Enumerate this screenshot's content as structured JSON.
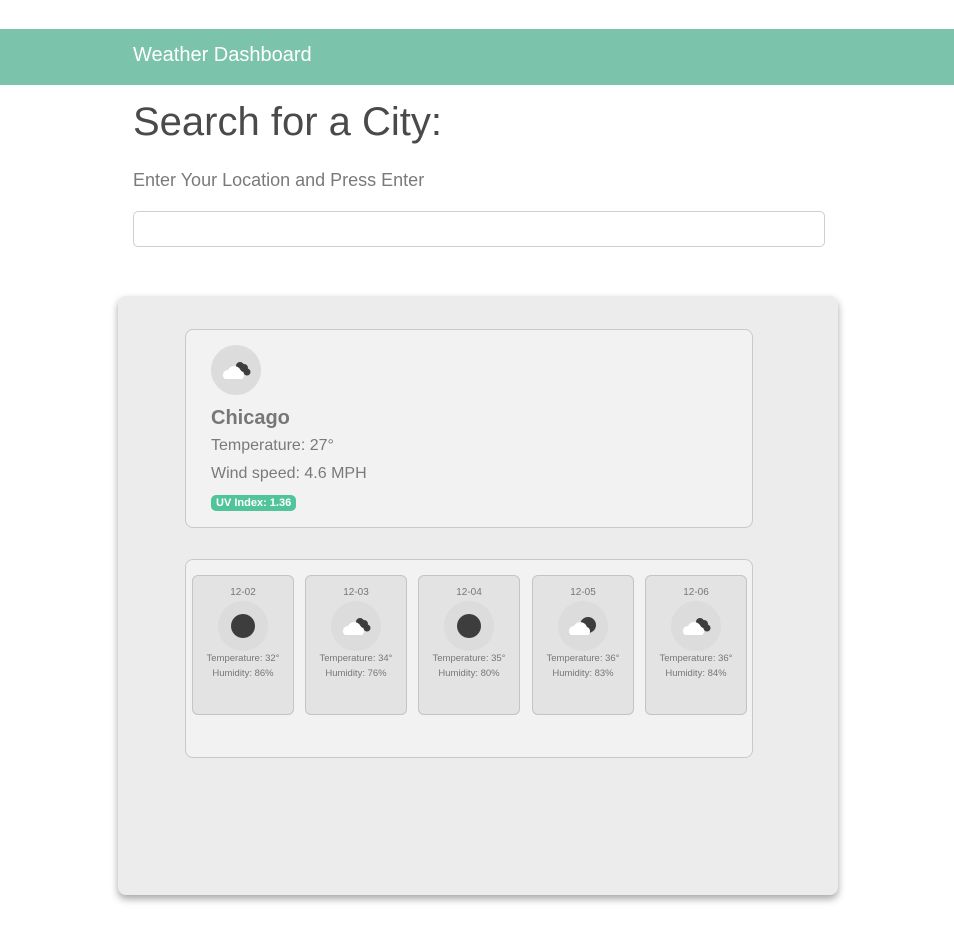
{
  "navbar": {
    "title": "Weather Dashboard"
  },
  "search": {
    "heading": "Search for a City:",
    "subheading": "Enter Your Location and Press Enter",
    "value": "",
    "placeholder": ""
  },
  "current": {
    "icon": "partly-cloudy-icon",
    "city": "Chicago",
    "temperature": "Temperature: 27°",
    "wind": "Wind speed: 4.6 MPH",
    "uv": "UV Index: 1.36"
  },
  "forecast": [
    {
      "date": "12-02",
      "icon": "clear-icon",
      "temperature": "Temperature: 32°",
      "humidity": "Humidity: 86%"
    },
    {
      "date": "12-03",
      "icon": "partly-cloudy-icon",
      "temperature": "Temperature: 34°",
      "humidity": "Humidity: 76%"
    },
    {
      "date": "12-04",
      "icon": "clear-icon",
      "temperature": "Temperature: 35°",
      "humidity": "Humidity: 80%"
    },
    {
      "date": "12-05",
      "icon": "cloudy-icon",
      "temperature": "Temperature: 36°",
      "humidity": "Humidity: 83%"
    },
    {
      "date": "12-06",
      "icon": "partly-cloudy-icon",
      "temperature": "Temperature: 36°",
      "humidity": "Humidity: 84%"
    }
  ],
  "colors": {
    "navbar": "#7bc3ab",
    "uv_badge": "#52c49c",
    "panel": "#ececec"
  }
}
